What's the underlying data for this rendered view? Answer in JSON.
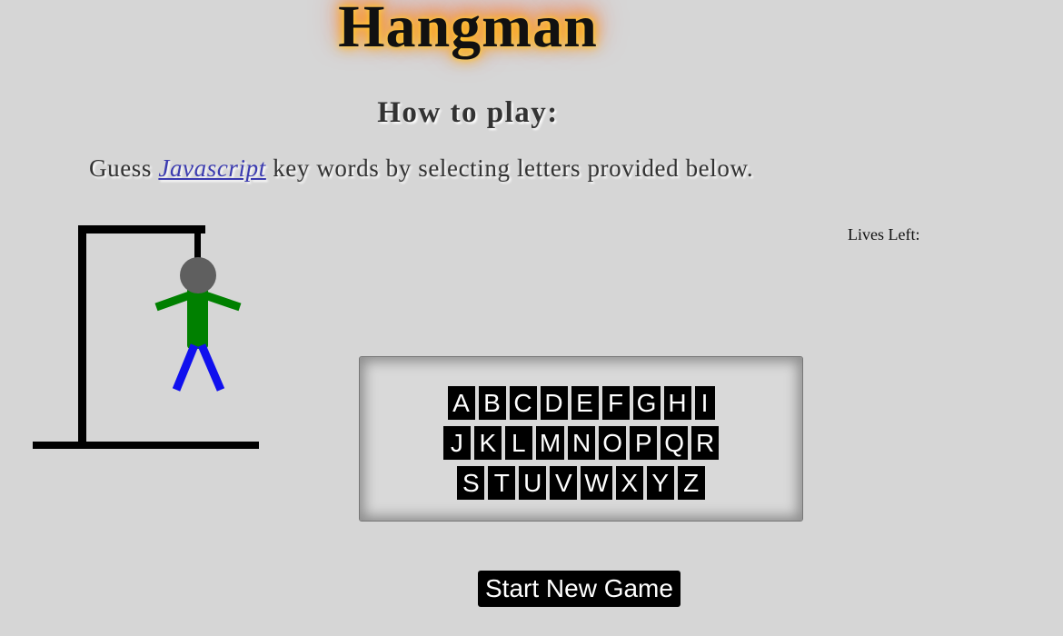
{
  "title": "Hangman",
  "how_to_play": {
    "heading": "How to play:",
    "text_before": "Guess ",
    "link_text": "Javascript",
    "text_after": " key words by selecting letters provided below."
  },
  "lives": {
    "label": "Lives Left:",
    "value": ""
  },
  "hangman": {
    "parts_shown": [
      "gallows-base",
      "gallows-pole",
      "gallows-beam",
      "rope",
      "head",
      "body",
      "left-arm",
      "right-arm",
      "left-leg",
      "right-leg"
    ],
    "colors": {
      "gallows": "#000000",
      "head": "#5f5f5f",
      "body": "#008000",
      "arms": "#008000",
      "legs": "#1010ee"
    }
  },
  "keyboard": {
    "rows": [
      [
        "A",
        "B",
        "C",
        "D",
        "E",
        "F",
        "G",
        "H",
        "I"
      ],
      [
        "J",
        "K",
        "L",
        "M",
        "N",
        "O",
        "P",
        "Q",
        "R"
      ],
      [
        "S",
        "T",
        "U",
        "V",
        "W",
        "X",
        "Y",
        "Z"
      ]
    ]
  },
  "start_button": {
    "label": "Start New Game"
  },
  "colors": {
    "background": "#d6d6d6",
    "key_background": "#000000",
    "key_text": "#ffffff",
    "link": "#3b3bb0"
  }
}
